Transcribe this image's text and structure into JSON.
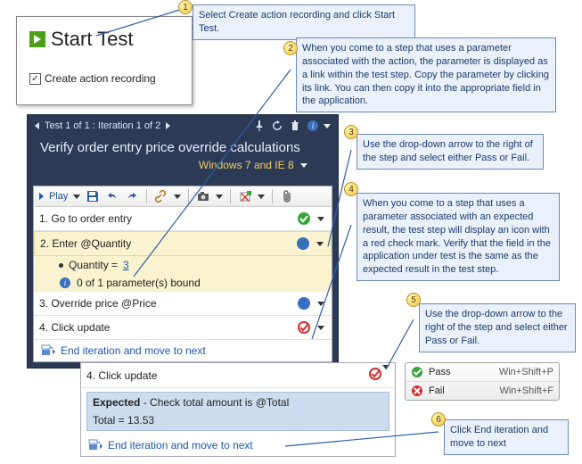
{
  "callouts": {
    "c1": "Select Create action recording and click Start Test.",
    "c2": "When you come to a step that uses a parameter associated with the action, the parameter is displayed as a link within the test step. Copy the parameter by clicking its link. You can then copy it into the appropriate field in the application.",
    "c3": "Use the drop-down arrow to the right of the step and select either Pass or Fail.",
    "c4": "When you come to a step that uses a parameter associated with an expected result, the test step will display an icon with a red check mark. Verify that the field in the application under test is the same as the expected result in the test step.",
    "c5": "Use the drop-down arrow to the right of the step and select either Pass or Fail.",
    "c6": "Click End iteration and move to next"
  },
  "start_box": {
    "title": "Start Test",
    "checkbox_label": "Create action recording"
  },
  "runner": {
    "title_bar": "Test 1 of 1 : Iteration 1 of 2",
    "test_title": "Verify order entry price override calculations",
    "env": "Windows 7 and IE 8",
    "toolbar": {
      "play": "Play",
      "save_icon": "save",
      "undo_icon": "undo",
      "redo_icon": "redo"
    },
    "steps": [
      {
        "label": "1. Go to order entry"
      },
      {
        "label": "2. Enter @Quantity",
        "sub_quantity_label": "Quantity = ",
        "sub_quantity_value": "3",
        "bound_text": "0 of 1 parameter(s) bound"
      },
      {
        "label": "3. Override price @Price"
      },
      {
        "label": "4. Click update"
      }
    ],
    "end_iteration": "End iteration and move to next"
  },
  "detail": {
    "step_label": "4. Click update",
    "expected_prefix": "Expected",
    "expected_rest": " - Check total amount is @Total",
    "total_line": "Total = 13.53",
    "end_iteration": "End iteration and move to next"
  },
  "passfail": {
    "pass": "Pass",
    "pass_short": "Win+Shift+P",
    "fail": "Fail",
    "fail_short": "Win+Shift+F"
  }
}
